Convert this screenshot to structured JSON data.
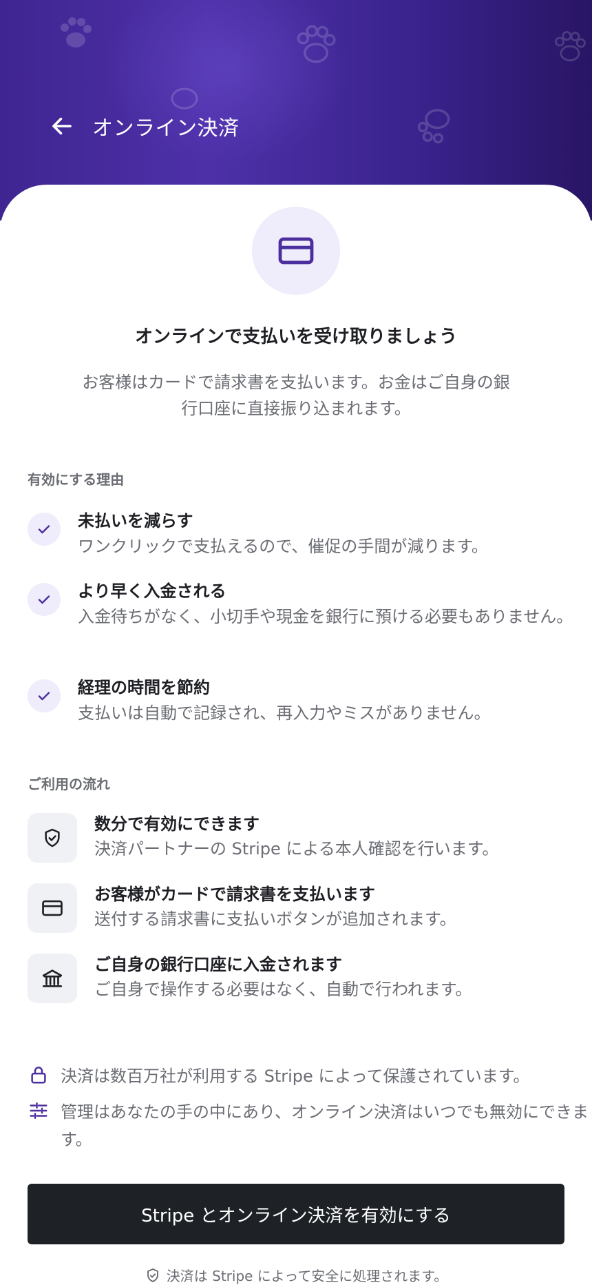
{
  "header": {
    "title": "オンライン決済",
    "back_icon": "arrow-left-icon"
  },
  "colors": {
    "hero_bg": "#4d30a8",
    "accent": "#4b2f9e",
    "cta_bg": "#1e2227",
    "icon_circle_bg": "#efecfb"
  },
  "hero": {
    "icon": "credit-card-icon",
    "headline": "オンラインで支払いを受け取りましょう",
    "subtext": "お客様はカードで請求書を支払います。お金はご自身の銀行口座に直接振り込まれます。"
  },
  "benefits": {
    "title": "有効にする理由",
    "items": [
      {
        "icon": "check-icon",
        "title": "未払いを減らす",
        "desc": "ワンクリックで支払えるので、催促の手間が減ります。"
      },
      {
        "icon": "check-icon",
        "title": "より早く入金される",
        "desc": "入金待ちがなく、小切手や現金を銀行に預ける必要もありません。"
      },
      {
        "icon": "check-icon",
        "title": "経理の時間を節約",
        "desc": "支払いは自動で記録され、再入力やミスがありません。"
      }
    ]
  },
  "flow": {
    "title": "ご利用の流れ",
    "items": [
      {
        "icon": "shield-check-icon",
        "title": "数分で有効にできます",
        "desc": "決済パートナーの Stripe による本人確認を行います。"
      },
      {
        "icon": "credit-card-icon",
        "title": "お客様がカードで請求書を支払います",
        "desc": "送付する請求書に支払いボタンが追加されます。"
      },
      {
        "icon": "bank-icon",
        "title": "ご自身の銀行口座に入金されます",
        "desc": "ご自身で操作する必要はなく、自動で行われます。"
      }
    ]
  },
  "notes": [
    {
      "icon": "lock-icon",
      "text": "決済は数百万社が利用する Stripe によって保護されています。"
    },
    {
      "icon": "sliders-icon",
      "text": "管理はあなたの手の中にあり、オンライン決済はいつでも無効にできます。"
    }
  ],
  "cta": {
    "label": "Stripe とオンライン決済を有効にする"
  },
  "footer": {
    "icon": "shield-check-icon",
    "text": "決済は Stripe によって安全に処理されます。"
  }
}
